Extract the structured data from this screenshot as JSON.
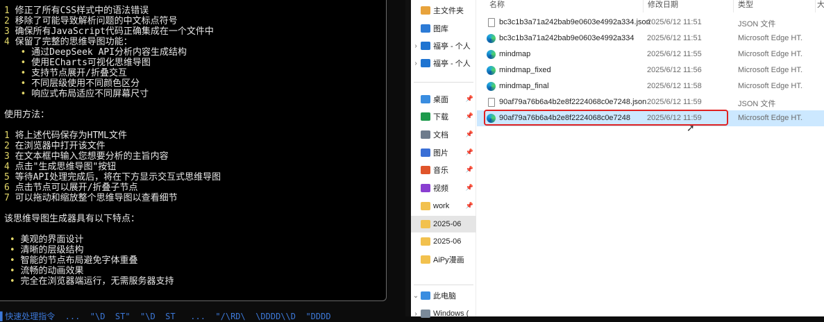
{
  "terminal": {
    "lines": [
      {
        "n": "1",
        "t": " 修正了所有CSS样式中的语法错误"
      },
      {
        "n": "2",
        "t": " 移除了可能导致解析问题的中文标点符号"
      },
      {
        "n": "3",
        "t": " 确保所有JavaScript代码正确集成在一个文件中"
      },
      {
        "n": "4",
        "t": " 保留了完整的思维导图功能："
      },
      {
        "b": "   •",
        "t": " 通过DeepSeek API分析内容生成结构"
      },
      {
        "b": "   •",
        "t": " 使用ECharts可视化思维导图"
      },
      {
        "b": "   •",
        "t": " 支持节点展开/折叠交互"
      },
      {
        "b": "   •",
        "t": " 不同层级使用不同颜色区分"
      },
      {
        "b": "   •",
        "t": " 响应式布局适应不同屏幕尺寸"
      },
      {
        "t": ""
      },
      {
        "t": "使用方法："
      },
      {
        "t": ""
      },
      {
        "n": "1",
        "t": " 将上述代码保存为HTML文件"
      },
      {
        "n": "2",
        "t": " 在浏览器中打开该文件"
      },
      {
        "n": "3",
        "t": " 在文本框中输入您想要分析的主旨内容"
      },
      {
        "n": "4",
        "t": " 点击\"生成思维导图\"按钮"
      },
      {
        "n": "5",
        "t": " 等待API处理完成后，将在下方显示交互式思维导图"
      },
      {
        "n": "6",
        "t": " 点击节点可以展开/折叠子节点"
      },
      {
        "n": "7",
        "t": " 可以拖动和缩放整个思维导图以查看细节"
      },
      {
        "t": ""
      },
      {
        "t": "该思维导图生成器具有以下特点："
      },
      {
        "t": ""
      },
      {
        "b": " •",
        "t": " 美观的界面设计"
      },
      {
        "b": " •",
        "t": " 清晰的层级结构"
      },
      {
        "b": " •",
        "t": " 智能的节点布局避免字体重叠"
      },
      {
        "b": " •",
        "t": " 流畅的动画效果"
      },
      {
        "b": " •",
        "t": " 完全在浏览器端运行，无需服务器支持"
      }
    ],
    "bottom_line": "▌快速处理指令  ...  \"\\D  ST\"  \"\\D  ST   ...  \"/\\RD\\  \\DDDD\\\\D  \"DDDD"
  },
  "nav": {
    "items": [
      {
        "label": "主文件夹",
        "icon": "home-icon",
        "color": "#e8a33c",
        "chev": "",
        "pin": false
      },
      {
        "label": "图库",
        "icon": "gallery-icon",
        "color": "#2d7bd6",
        "chev": "",
        "pin": false
      },
      {
        "label": "福亭 - 个人",
        "icon": "cloud-icon",
        "color": "#1f74d1",
        "chev": "›",
        "pin": false
      },
      {
        "label": "福亭 - 个人",
        "icon": "cloud-icon",
        "color": "#1f74d1",
        "chev": "›",
        "pin": false
      },
      {
        "label": "桌面",
        "icon": "desktop-icon",
        "color": "#3a8de0",
        "chev": "",
        "pin": true
      },
      {
        "label": "下载",
        "icon": "download-icon",
        "color": "#1e9a4c",
        "chev": "",
        "pin": true
      },
      {
        "label": "文档",
        "icon": "documents-icon",
        "color": "#6d7b8c",
        "chev": "",
        "pin": true
      },
      {
        "label": "图片",
        "icon": "pictures-icon",
        "color": "#3a6fd6",
        "chev": "",
        "pin": true
      },
      {
        "label": "音乐",
        "icon": "music-icon",
        "color": "#e0552b",
        "chev": "",
        "pin": true
      },
      {
        "label": "视频",
        "icon": "videos-icon",
        "color": "#8a3fd1",
        "chev": "",
        "pin": true
      },
      {
        "label": "work",
        "icon": "folder-icon",
        "color": "#f2c14e",
        "chev": "",
        "pin": true
      },
      {
        "label": "2025-06",
        "icon": "folder-icon",
        "color": "#f2c14e",
        "chev": "",
        "pin": false,
        "selected": true
      },
      {
        "label": "2025-06",
        "icon": "folder-icon",
        "color": "#f2c14e",
        "chev": "",
        "pin": false
      },
      {
        "label": "AiPy漫画",
        "icon": "folder-icon",
        "color": "#f2c14e",
        "chev": "",
        "pin": false
      },
      {
        "label": "此电脑",
        "icon": "computer-icon",
        "color": "#3a8de0",
        "chev": "⌄",
        "pin": false
      },
      {
        "label": "Windows (",
        "icon": "drive-icon",
        "color": "#7a8a9a",
        "chev": "›",
        "pin": false
      }
    ]
  },
  "columns": {
    "name": "名称",
    "date": "修改日期",
    "type": "类型",
    "size": "大"
  },
  "files": [
    {
      "name": "bc3c1b3a71a242bab9e0603e4992a334.json",
      "date": "2025/6/12 11:51",
      "type": "JSON 文件",
      "icon": "json-file-icon"
    },
    {
      "name": "bc3c1b3a71a242bab9e0603e4992a334",
      "date": "2025/6/12 11:51",
      "type": "Microsoft Edge HT...",
      "icon": "edge-icon"
    },
    {
      "name": "mindmap",
      "date": "2025/6/12 11:55",
      "type": "Microsoft Edge HT...",
      "icon": "edge-icon"
    },
    {
      "name": "mindmap_fixed",
      "date": "2025/6/12 11:56",
      "type": "Microsoft Edge HT...",
      "icon": "edge-icon"
    },
    {
      "name": "mindmap_final",
      "date": "2025/6/12 11:58",
      "type": "Microsoft Edge HT...",
      "icon": "edge-icon"
    },
    {
      "name": "90af79a76b6a4b2e8f2224068c0e7248.json",
      "date": "2025/6/12 11:59",
      "type": "JSON 文件",
      "icon": "json-file-icon"
    },
    {
      "name": "90af79a76b6a4b2e8f2224068c0e7248",
      "date": "2025/6/12 11:59",
      "type": "Microsoft Edge HT...",
      "icon": "edge-icon",
      "selected": true
    }
  ],
  "colors": {
    "highlight": "#e02020",
    "selection": "#cce8ff",
    "terminal_accent": "#e3d86a"
  }
}
